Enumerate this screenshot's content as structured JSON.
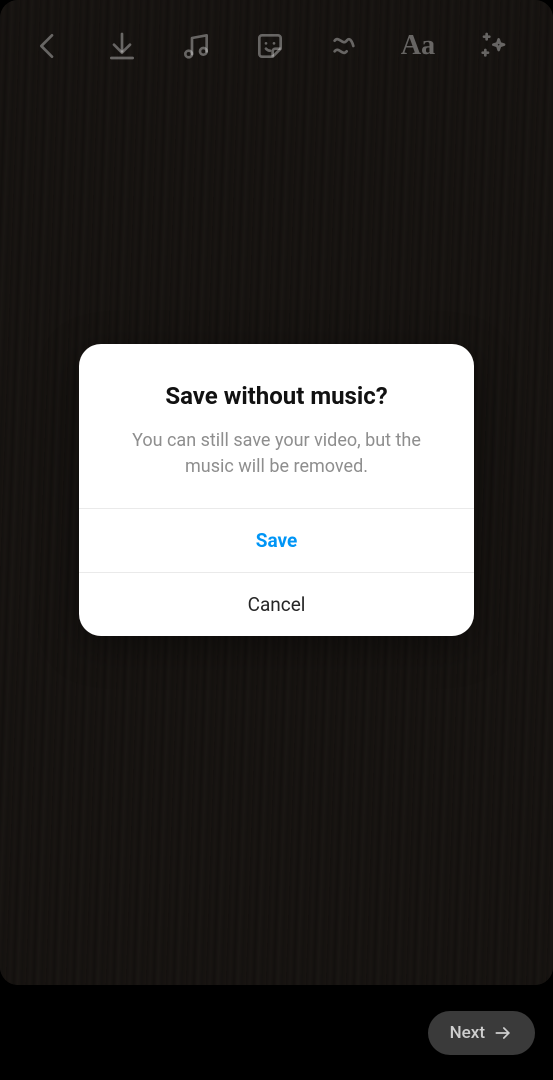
{
  "toolbar": {
    "text_label": "Aa"
  },
  "dialog": {
    "title": "Save without music?",
    "message": "You can still save your video, but the music will be removed.",
    "primary_action": "Save",
    "secondary_action": "Cancel"
  },
  "bottom": {
    "next_label": "Next"
  },
  "colors": {
    "primary_blue": "#0095f6"
  }
}
